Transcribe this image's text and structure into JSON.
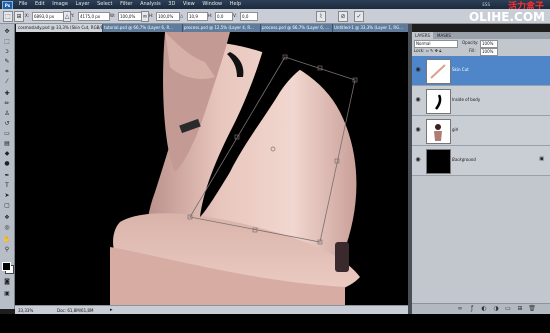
{
  "app": {
    "logo": "Ps"
  },
  "menu": [
    "File",
    "Edit",
    "Image",
    "Layer",
    "Select",
    "Filter",
    "Analysis",
    "3D",
    "View",
    "Window",
    "Help"
  ],
  "watermarks": {
    "cn": "活力盒子",
    "site": "OLIHE.COM",
    "ess": "ESS"
  },
  "options": {
    "x": "6893,0 px",
    "y": "4175,0 px",
    "w": "100,0%",
    "h": "100,0%",
    "angle": "10,9",
    "h_skew": "0,0",
    "v_skew": "0,0",
    "w_label": "W:",
    "h_label": "H:",
    "x_label": "X:",
    "y_label": "Y:",
    "angle_label": "△",
    "h_label2": "H:",
    "v_label": "V:"
  },
  "doc_tabs": [
    {
      "label": "cosmoslady.psd @ 33,3% (Skin Cut, RGB/8*)",
      "active": true
    },
    {
      "label": "tutorial.psd @ 66,7% (Layer 6, R...",
      "active": false
    },
    {
      "label": "process.psd @ 12,5% (Layer 4, R...",
      "active": false
    },
    {
      "label": "process.psd @ 66,7% (Layer 6, ...",
      "active": false
    },
    {
      "label": "Untitled-1 @ 33,3% (Layer 1, RG...",
      "active": false
    }
  ],
  "status": {
    "zoom": "33,33%",
    "doc": "Doc: 61,8M/61,8M"
  },
  "panels": {
    "tabs": [
      "LAYERS",
      "MASKS"
    ],
    "blend_mode": "Normal",
    "opacity_label": "Opacity:",
    "opacity": "100%",
    "lock_label": "Lock:",
    "fill_label": "Fill:",
    "fill": "100%",
    "layers": [
      {
        "name": "Skin Cut",
        "selected": true,
        "thumb": "checker-tan"
      },
      {
        "name": "Inside of body",
        "selected": false,
        "thumb": "checker-black"
      },
      {
        "name": "girl",
        "selected": false,
        "thumb": "portrait"
      },
      {
        "name": "Background",
        "selected": false,
        "thumb": "black"
      }
    ]
  },
  "colors": {
    "accent": "#4f86c9",
    "skin": "#e0b8ac",
    "canvas": "#000000"
  }
}
